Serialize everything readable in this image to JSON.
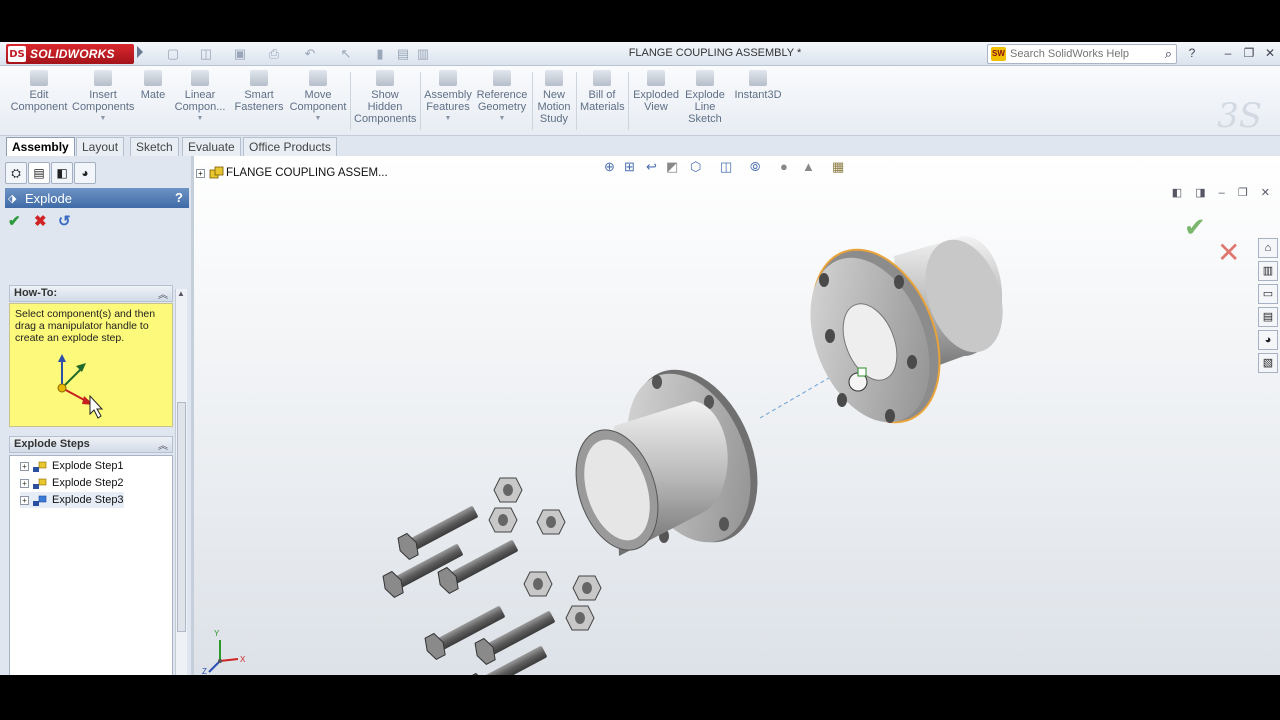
{
  "app": {
    "brand_mark": "DS",
    "brand_name": "SOLIDWORKS",
    "document_title": "FLANGE COUPLING ASSEMBLY *"
  },
  "help_search": {
    "placeholder": "Search SolidWorks Help"
  },
  "toolbar": {
    "items": [
      {
        "label": "Edit\nComponent",
        "icon": "edit-component-icon"
      },
      {
        "label": "Insert\nComponents",
        "icon": "insert-components-icon"
      },
      {
        "label": "Mate",
        "icon": "mate-icon"
      },
      {
        "label": "Linear\nCompon...",
        "icon": "linear-pattern-icon"
      },
      {
        "label": "Smart\nFasteners",
        "icon": "smart-fasteners-icon"
      },
      {
        "label": "Move\nComponent",
        "icon": "move-component-icon"
      },
      {
        "label": "Show\nHidden\nComponents",
        "icon": "show-hidden-icon"
      },
      {
        "label": "Assembly\nFeatures",
        "icon": "assembly-features-icon"
      },
      {
        "label": "Reference\nGeometry",
        "icon": "reference-geometry-icon"
      },
      {
        "label": "New\nMotion\nStudy",
        "icon": "motion-study-icon"
      },
      {
        "label": "Bill of\nMaterials",
        "icon": "bom-icon"
      },
      {
        "label": "Exploded\nView",
        "icon": "exploded-view-icon"
      },
      {
        "label": "Explode\nLine\nSketch",
        "icon": "explode-line-icon"
      },
      {
        "label": "Instant3D",
        "icon": "instant3d-icon"
      }
    ]
  },
  "tabs": [
    "Assembly",
    "Layout",
    "Sketch",
    "Evaluate",
    "Office Products"
  ],
  "property_manager": {
    "title": "Explode",
    "help": "?",
    "howto": {
      "header": "How-To:",
      "text": "Select component(s) and then drag a manipulator handle to create an explode step."
    },
    "steps": {
      "header": "Explode Steps",
      "items": [
        "Explode Step1",
        "Explode Step2",
        "Explode Step3"
      ]
    }
  },
  "tree": {
    "root": "FLANGE COUPLING ASSEM..."
  },
  "triad": {
    "x": "X",
    "y": "Y",
    "z": "Z"
  },
  "colors": {
    "accent": "#3e6aa6",
    "howto_bg": "#fdf97a",
    "selection": "#e8a33a"
  }
}
